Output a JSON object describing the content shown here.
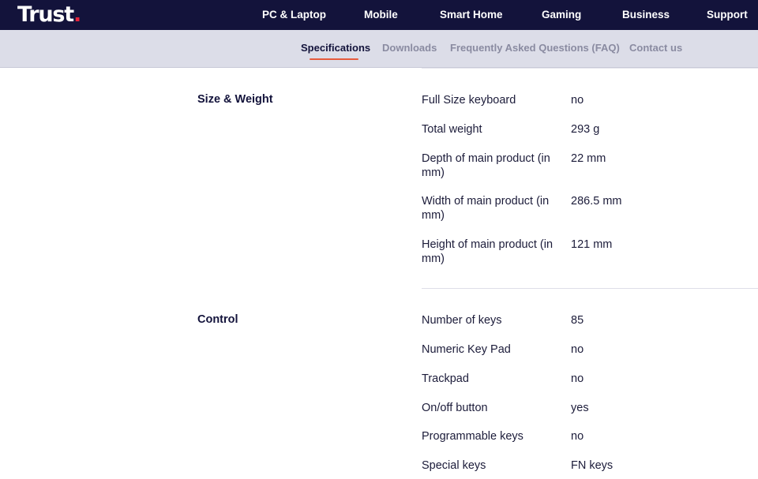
{
  "header": {
    "logo_text": "Trust",
    "logo_dot": ".",
    "nav": [
      "PC & Laptop",
      "Mobile",
      "Smart Home",
      "Gaming",
      "Business",
      "Support"
    ]
  },
  "subnav": {
    "items": [
      "Specifications",
      "Downloads",
      "Frequently Asked Questions (FAQ)",
      "Contact us"
    ],
    "active": "Specifications"
  },
  "colors": {
    "header_bg": "#13133b",
    "subnav_bg": "#dcdde8",
    "accent_underline": "#e65a3c",
    "logo_dot": "#e6233c"
  },
  "sections": [
    {
      "title": "Size & Weight",
      "specs": [
        {
          "label": "Full Size keyboard",
          "value": "no"
        },
        {
          "label": "Total weight",
          "value": "293 g"
        },
        {
          "label": "Depth of main product (in mm)",
          "value": "22 mm"
        },
        {
          "label": "Width of main product (in mm)",
          "value": "286.5 mm"
        },
        {
          "label": "Height of main product (in mm)",
          "value": "121 mm"
        }
      ]
    },
    {
      "title": "Control",
      "specs": [
        {
          "label": "Number of keys",
          "value": "85"
        },
        {
          "label": "Numeric Key Pad",
          "value": "no"
        },
        {
          "label": "Trackpad",
          "value": "no"
        },
        {
          "label": "On/off button",
          "value": "yes"
        },
        {
          "label": "Programmable keys",
          "value": "no"
        },
        {
          "label": "Special keys",
          "value": "FN keys"
        }
      ]
    }
  ]
}
